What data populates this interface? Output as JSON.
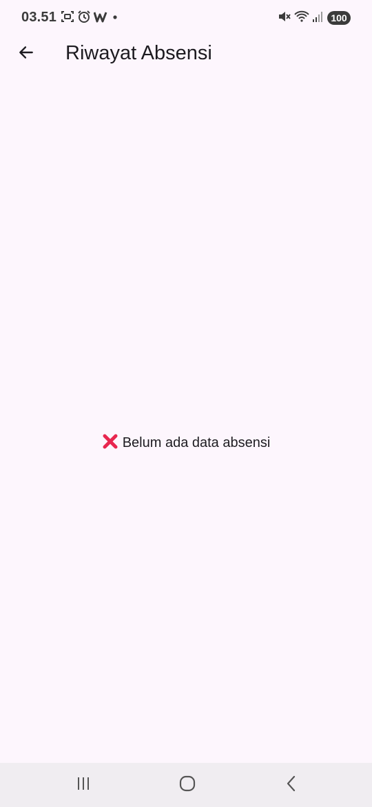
{
  "status_bar": {
    "time": "03.51",
    "battery": "100",
    "icons_left": [
      "screenshot-icon",
      "alarm-icon",
      "w-app-icon",
      "dot-icon"
    ],
    "icons_right": [
      "mute-icon",
      "wifi-icon",
      "signal-icon"
    ]
  },
  "app_bar": {
    "back_icon": "arrow-left-icon",
    "title": "Riwayat Absensi"
  },
  "empty_state": {
    "icon": "cross-mark-icon",
    "message": "Belum ada data absensi"
  },
  "nav_bar": {
    "buttons": [
      "recent-apps",
      "home",
      "back"
    ]
  },
  "colors": {
    "background": "#fdf6fd",
    "text": "#1d1b20",
    "cross_mark": "#e8264f",
    "nav_bar": "#f0edf1"
  }
}
